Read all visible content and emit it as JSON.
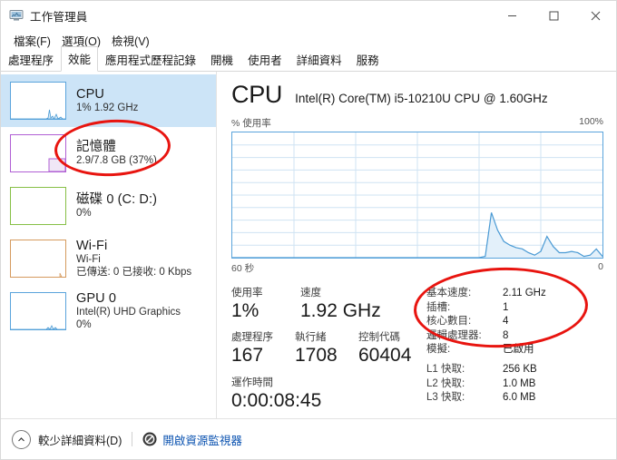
{
  "window": {
    "title": "工作管理員",
    "icon": "task-manager-icon",
    "minimize_label": "–",
    "maximize_label": "□",
    "close_label": "✕"
  },
  "menu": {
    "items": [
      {
        "label": "檔案(F)"
      },
      {
        "label": "選項(O)"
      },
      {
        "label": "檢視(V)"
      }
    ]
  },
  "tabs": {
    "items": [
      {
        "label": "處理程序",
        "active": false
      },
      {
        "label": "效能",
        "active": true
      },
      {
        "label": "應用程式歷程記錄",
        "active": false
      },
      {
        "label": "開機",
        "active": false
      },
      {
        "label": "使用者",
        "active": false
      },
      {
        "label": "詳細資料",
        "active": false
      },
      {
        "label": "服務",
        "active": false
      }
    ]
  },
  "sidebar": {
    "items": [
      {
        "name": "cpu",
        "title": "CPU",
        "sub1": "1%  1.92 GHz",
        "sub2": "",
        "color": "#4a90c4",
        "selected": true
      },
      {
        "name": "memory",
        "title": "記憶體",
        "sub1": "2.9/7.8 GB (37%)",
        "sub2": "",
        "color": "#b05fd4",
        "selected": false
      },
      {
        "name": "disk",
        "title": "磁碟 0 (C: D:)",
        "sub1": "0%",
        "sub2": "",
        "color": "#86bf45",
        "selected": false
      },
      {
        "name": "wifi",
        "title": "Wi-Fi",
        "sub1": "Wi-Fi",
        "sub2": "已傳送: 0 已接收: 0 Kbps",
        "color": "#d59a5e",
        "selected": false
      },
      {
        "name": "gpu",
        "title": "GPU 0",
        "sub1": "Intel(R) UHD Graphics",
        "sub2": "0%",
        "color": "#5aa4dc",
        "selected": false
      }
    ]
  },
  "detail": {
    "title": "CPU",
    "subtitle": "Intel(R) Core(TM) i5-10210U CPU @ 1.60GHz",
    "axis_y_label": "% 使用率",
    "axis_y_max": "100%",
    "axis_x_left": "60 秒",
    "axis_x_right": "0",
    "stats_left": [
      {
        "label": "使用率",
        "value": "1%"
      },
      {
        "label": "速度",
        "value": "1.92 GHz"
      },
      {
        "label": "處理程序",
        "value": "167"
      },
      {
        "label": "執行緒",
        "value": "1708"
      },
      {
        "label": "控制代碼",
        "value": "60404"
      },
      {
        "label": "運作時間",
        "value": "0:00:08:45"
      }
    ],
    "specs": [
      {
        "label": "基本速度:",
        "value": "2.11 GHz"
      },
      {
        "label": "插槽:",
        "value": "1"
      },
      {
        "label": "核心數目:",
        "value": "4"
      },
      {
        "label": "邏輯處理器:",
        "value": "8"
      },
      {
        "label": "模擬:",
        "value": "已啟用"
      },
      {
        "label": "L1 快取:",
        "value": "256 KB"
      },
      {
        "label": "L2 快取:",
        "value": "1.0 MB"
      },
      {
        "label": "L3 快取:",
        "value": "6.0 MB"
      }
    ]
  },
  "footer": {
    "collapse_label": "較少詳細資料(D)",
    "resource_monitor_label": "開啟資源監視器"
  },
  "annotations": [
    {
      "name": "memory-highlight",
      "color": "#e8140f"
    },
    {
      "name": "cpu-spec-highlight",
      "color": "#e8140f"
    }
  ],
  "chart_data": {
    "type": "area",
    "title": "CPU % 使用率",
    "ylabel": "% 使用率",
    "xlabel": "60 秒",
    "ylim": [
      0,
      100
    ],
    "xlim": [
      60,
      0
    ],
    "grid": true,
    "legend": "none",
    "y_ticks": [
      "0%",
      "100%"
    ],
    "x_ticks": [
      "60 秒",
      "0"
    ],
    "line_color": "#4a9ad4",
    "fill_color": "#dcecf8",
    "x": [
      60,
      58,
      56,
      54,
      52,
      50,
      48,
      46,
      44,
      42,
      40,
      38,
      36,
      34,
      32,
      30,
      28,
      26,
      24,
      22,
      20,
      19,
      18,
      17,
      16,
      15,
      14,
      13,
      12,
      11,
      10,
      9,
      8,
      7,
      6,
      5,
      4,
      3,
      2,
      1,
      0
    ],
    "values": [
      0,
      0,
      0,
      0,
      0,
      0,
      0,
      0,
      0,
      0,
      0,
      0,
      0,
      0,
      0,
      0,
      0,
      0,
      0,
      0,
      0,
      1,
      36,
      22,
      13,
      10,
      8,
      7,
      4,
      2,
      5,
      17,
      9,
      4,
      4,
      5,
      4,
      1,
      2,
      7,
      1
    ]
  }
}
